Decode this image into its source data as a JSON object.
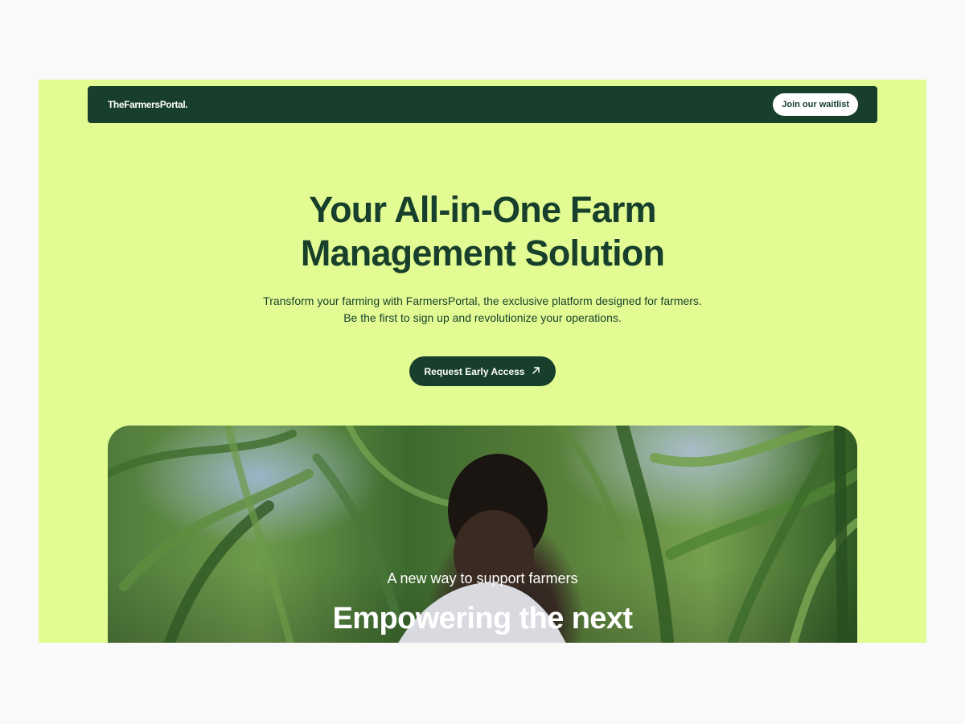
{
  "nav": {
    "logo": "TheFarmersPortal.",
    "waitlist_label": "Join our waitlist"
  },
  "hero": {
    "title_line1": "Your All-in-One Farm",
    "title_line2": "Management Solution",
    "subtitle": "Transform your farming with FarmersPortal, the exclusive platform designed for farmers. Be the first to sign up and revolutionize your operations.",
    "cta_label": "Request Early Access",
    "cta_icon": "arrow-up-right-icon"
  },
  "photo": {
    "kicker": "A new way to support farmers",
    "heading": "Empowering the next"
  },
  "colors": {
    "page_bg": "#e2fb93",
    "brand_dark": "#173f2b",
    "white": "#ffffff"
  }
}
